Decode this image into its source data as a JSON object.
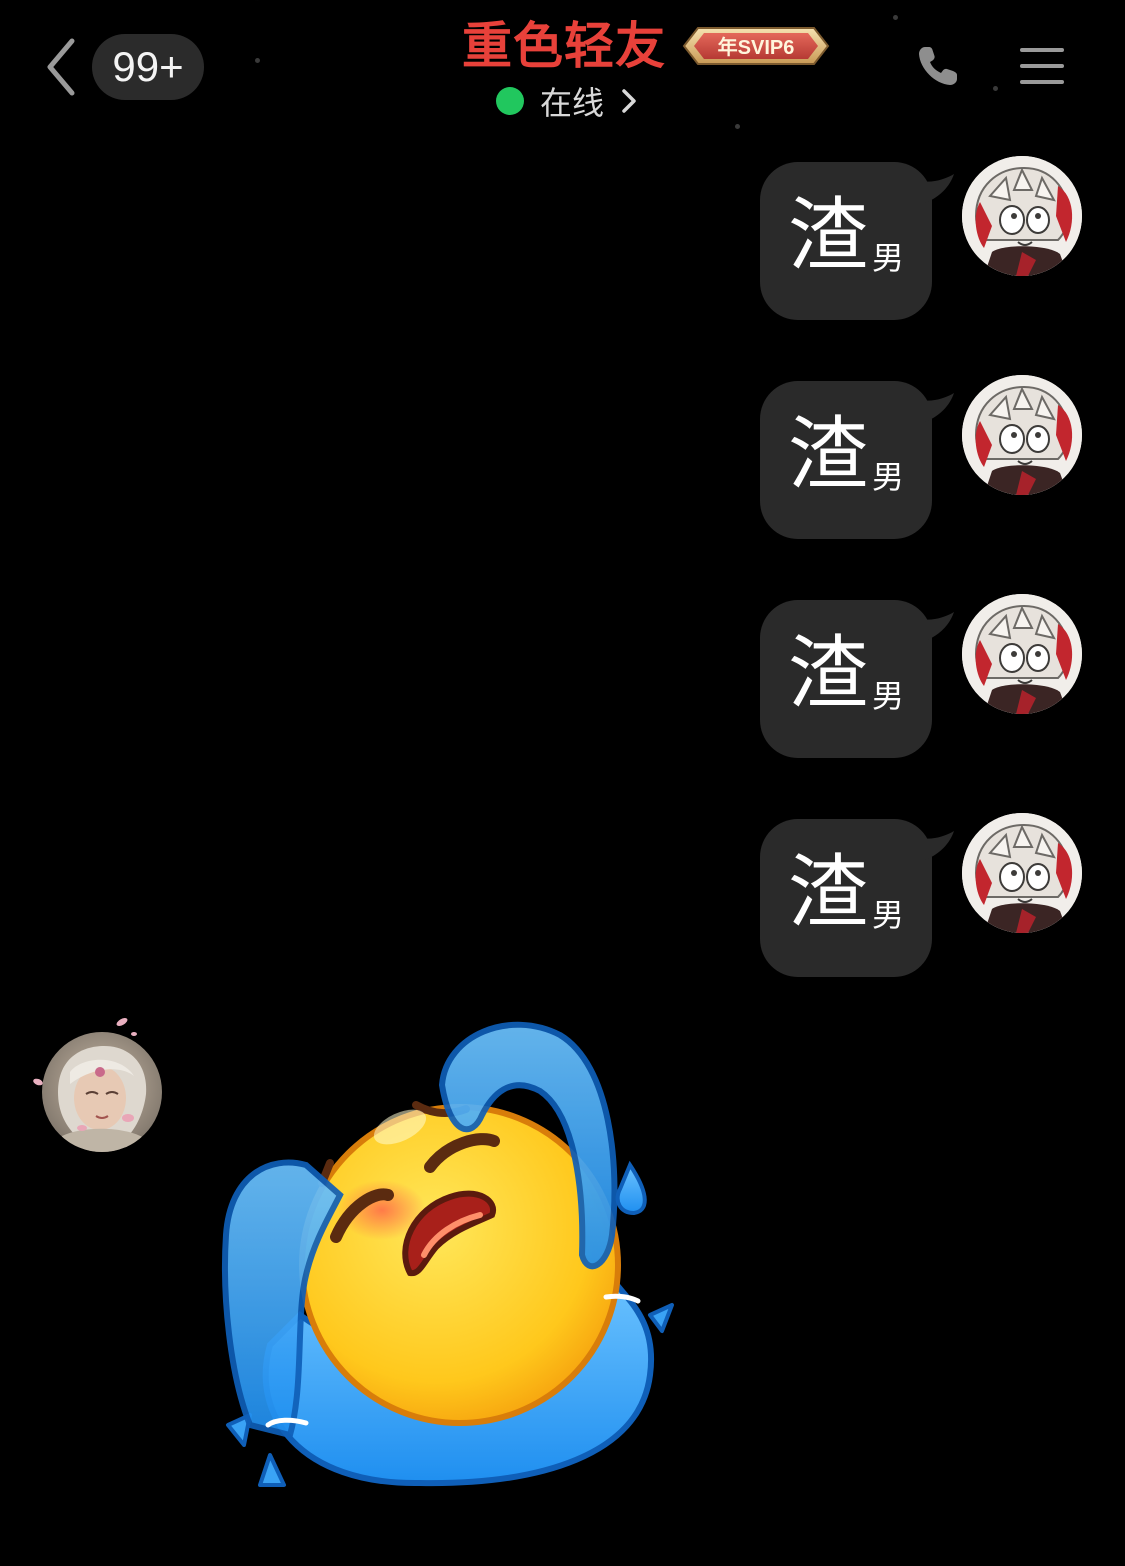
{
  "header": {
    "back_label": "返回",
    "unread_count": "99+",
    "contact_name": "重色轻友",
    "svip_badge": "年SVIP6",
    "status_text": "在线",
    "call_icon": "phone-icon",
    "menu_icon": "hamburger-menu-icon"
  },
  "colors": {
    "background": "#000000",
    "name": "#e8413a",
    "online_dot": "#21c75e",
    "bubble": "#2a2a2a"
  },
  "messages": [
    {
      "sender": "self",
      "main_text": "渣",
      "suffix_text": "男"
    },
    {
      "sender": "self",
      "main_text": "渣",
      "suffix_text": "男"
    },
    {
      "sender": "self",
      "main_text": "渣",
      "suffix_text": "男"
    },
    {
      "sender": "self",
      "main_text": "渣",
      "suffix_text": "男"
    },
    {
      "sender": "other",
      "type": "sticker",
      "sticker": "crying-emoji-sticker"
    }
  ]
}
